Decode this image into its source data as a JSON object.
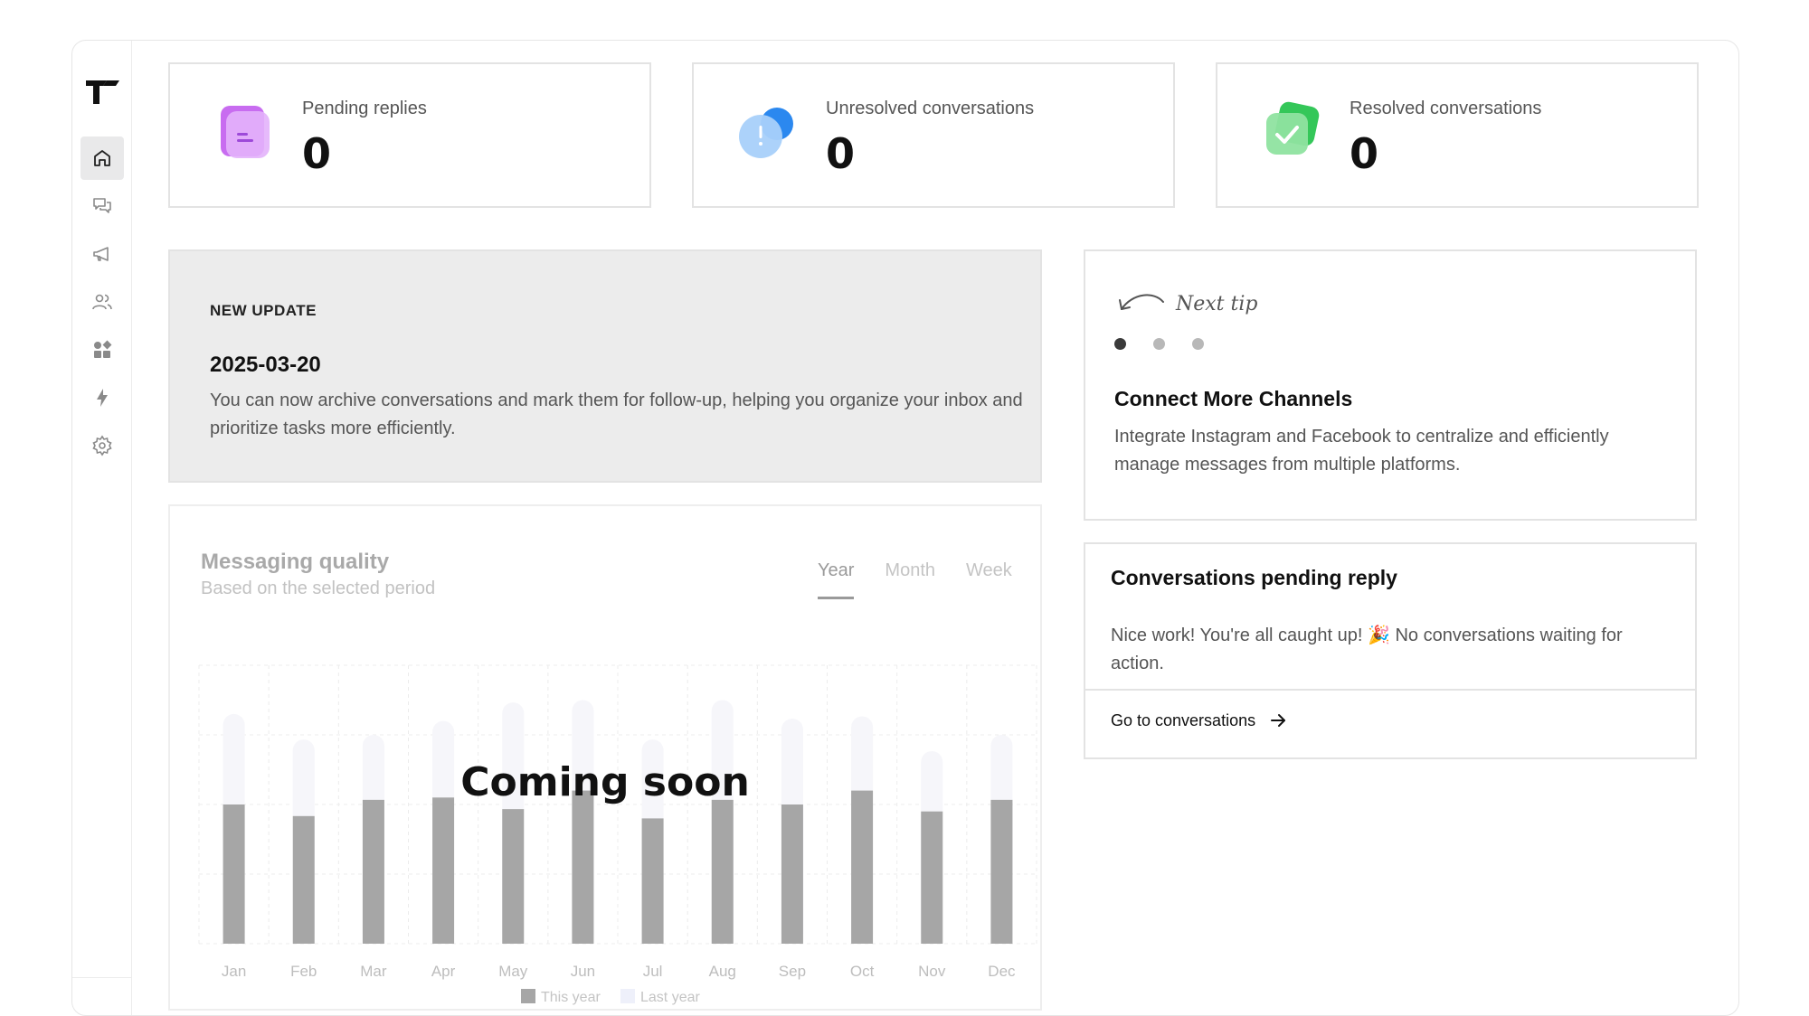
{
  "stats": [
    {
      "label": "Pending replies",
      "value": "0"
    },
    {
      "label": "Unresolved conversations",
      "value": "0"
    },
    {
      "label": "Resolved conversations",
      "value": "0"
    }
  ],
  "update": {
    "tag": "NEW UPDATE",
    "date": "2025-03-20",
    "text": "You can now archive conversations and mark them for follow-up, helping you organize your inbox and prioritize tasks more efficiently."
  },
  "tip": {
    "next_label": "Next tip",
    "title": "Connect More Channels",
    "body": "Integrate Instagram and Facebook to centralize and efficiently manage messages from multiple platforms.",
    "active_dot": 0
  },
  "pending": {
    "title": "Conversations pending reply",
    "body": "Nice work! You're all caught up! 🎉 No conversations waiting for action.",
    "link_label": "Go to conversations"
  },
  "quality": {
    "title": "Messaging quality",
    "subtitle": "Based on the selected period",
    "tabs": [
      "Year",
      "Month",
      "Week"
    ],
    "active_tab": "Year",
    "overlay": "Coming soon"
  },
  "chart_data": {
    "type": "bar",
    "categories": [
      "Jan",
      "Feb",
      "Mar",
      "Apr",
      "May",
      "Jun",
      "Jul",
      "Aug",
      "Sep",
      "Oct",
      "Nov",
      "Dec"
    ],
    "series": [
      {
        "name": "This year",
        "values": [
          60,
          55,
          62,
          63,
          58,
          66,
          54,
          62,
          60,
          66,
          57,
          62
        ]
      },
      {
        "name": "Last year",
        "values": [
          99,
          88,
          90,
          96,
          104,
          105,
          88,
          105,
          97,
          98,
          83,
          90
        ]
      }
    ],
    "ylim": [
      0,
      120
    ],
    "grid": true,
    "legend": "bottom",
    "colors": {
      "this_year": "#a6a6a6",
      "last_year": "#f6f6fa"
    }
  },
  "colors": {
    "accent": "#111111",
    "sidebar_active": "#e9e9ea",
    "card_border": "#e3e3e3"
  },
  "sidebar": {
    "items": [
      {
        "icon": "home-icon"
      },
      {
        "icon": "chat-icon"
      },
      {
        "icon": "megaphone-icon"
      },
      {
        "icon": "users-icon"
      },
      {
        "icon": "apps-icon"
      },
      {
        "icon": "bolt-icon"
      },
      {
        "icon": "gear-icon"
      }
    ]
  }
}
